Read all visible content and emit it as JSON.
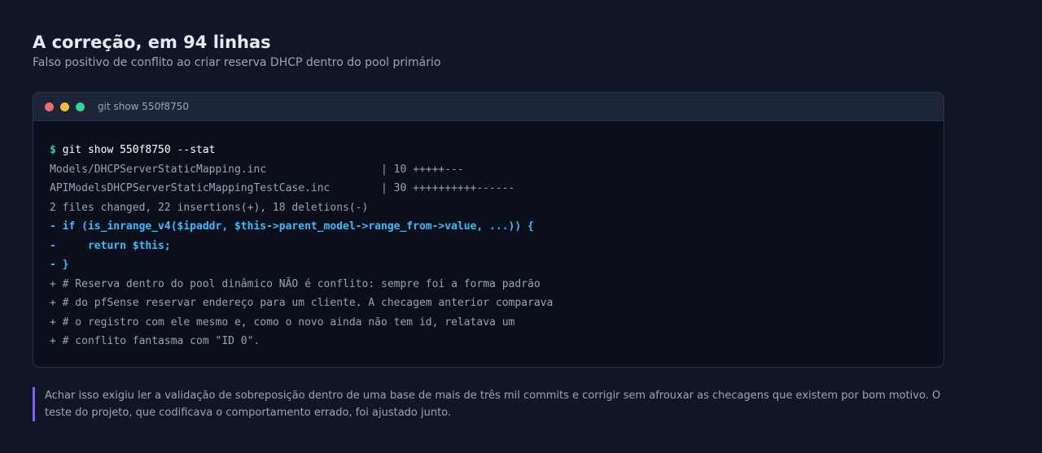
{
  "header": {
    "title": "A correção, em 94 linhas",
    "subtitle": "Falso positivo de conflito ao criar reserva DHCP dentro do pool primário"
  },
  "terminal": {
    "window_title": "git show 550f8750",
    "prompt_symbol": "$",
    "command": "git show 550f8750 --stat",
    "stat_lines": [
      "Models/DHCPServerStaticMapping.inc                  | 10 +++++---",
      "APIModelsDHCPServerStaticMappingTestCase.inc        | 30 ++++++++++------"
    ],
    "summary": "2 files changed, 22 insertions(+), 18 deletions(-)",
    "removed_lines": [
      "- if (is_inrange_v4($ipaddr, $this->parent_model->range_from->value, ...)) {",
      "-     return $this;",
      "- }"
    ],
    "added_lines": [
      "+ # Reserva dentro do pool dinâmico NÃO é conflito: sempre foi a forma padrão",
      "+ # do pfSense reservar endereço para um cliente. A checagem anterior comparava",
      "+ # o registro com ele mesmo e, como o novo ainda não tem id, relatava um",
      "+ # conflito fantasma com \"ID 0\"."
    ]
  },
  "note": {
    "text": "Achar isso exigiu ler a validação de sobreposição dentro de uma base de mais de três mil commits e corrigir sem afrouxar as checagens que existem por bom motivo. O teste do projeto, que codificava o comportamento errado, foi ajustado junto."
  },
  "colors": {
    "background": "#0f1626",
    "terminal_background": "#0a0f1b",
    "prompt": "#34d399",
    "removed_line": "#38bdf8",
    "note_accent": "#8b5cf6"
  },
  "icons": [
    "close-dot-icon",
    "minimize-dot-icon",
    "maximize-dot-icon"
  ]
}
